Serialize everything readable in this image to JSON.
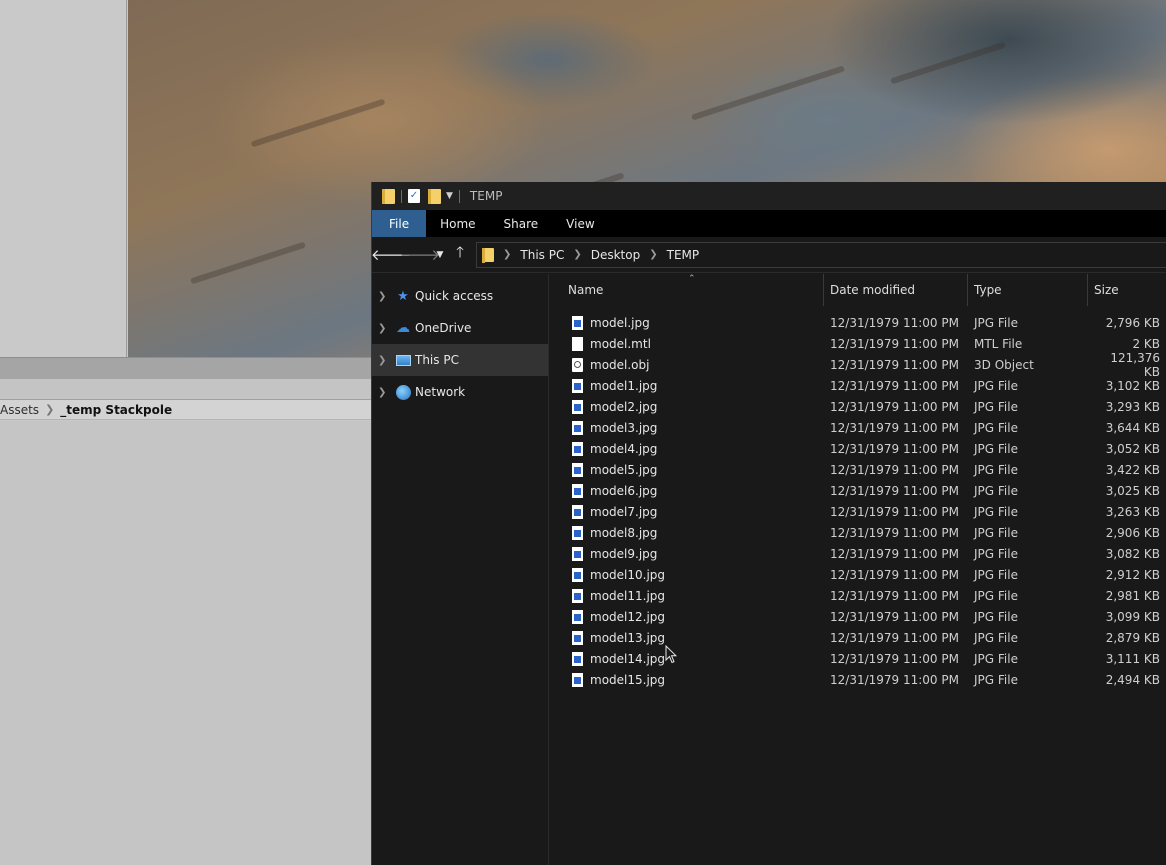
{
  "editor": {
    "breadcrumb": {
      "parent": "Assets",
      "current": "_temp Stackpole"
    }
  },
  "explorer": {
    "title": "TEMP",
    "ribbon_tabs": [
      "File",
      "Home",
      "Share",
      "View"
    ],
    "address": [
      "This PC",
      "Desktop",
      "TEMP"
    ],
    "nav_items": [
      {
        "label": "Quick access",
        "icon": "star-icon"
      },
      {
        "label": "OneDrive",
        "icon": "cloud-icon"
      },
      {
        "label": "This PC",
        "icon": "computer-icon",
        "selected": true
      },
      {
        "label": "Network",
        "icon": "network-icon"
      }
    ],
    "columns": {
      "name": "Name",
      "date": "Date modified",
      "type": "Type",
      "size": "Size"
    },
    "files": [
      {
        "name": "model.jpg",
        "date": "12/31/1979 11:00 PM",
        "type": "JPG File",
        "size": "2,796 KB",
        "icon": "jpg"
      },
      {
        "name": "model.mtl",
        "date": "12/31/1979 11:00 PM",
        "type": "MTL File",
        "size": "2 KB",
        "icon": "blank"
      },
      {
        "name": "model.obj",
        "date": "12/31/1979 11:00 PM",
        "type": "3D Object",
        "size": "121,376 KB",
        "icon": "obj"
      },
      {
        "name": "model1.jpg",
        "date": "12/31/1979 11:00 PM",
        "type": "JPG File",
        "size": "3,102 KB",
        "icon": "jpg"
      },
      {
        "name": "model2.jpg",
        "date": "12/31/1979 11:00 PM",
        "type": "JPG File",
        "size": "3,293 KB",
        "icon": "jpg"
      },
      {
        "name": "model3.jpg",
        "date": "12/31/1979 11:00 PM",
        "type": "JPG File",
        "size": "3,644 KB",
        "icon": "jpg"
      },
      {
        "name": "model4.jpg",
        "date": "12/31/1979 11:00 PM",
        "type": "JPG File",
        "size": "3,052 KB",
        "icon": "jpg"
      },
      {
        "name": "model5.jpg",
        "date": "12/31/1979 11:00 PM",
        "type": "JPG File",
        "size": "3,422 KB",
        "icon": "jpg"
      },
      {
        "name": "model6.jpg",
        "date": "12/31/1979 11:00 PM",
        "type": "JPG File",
        "size": "3,025 KB",
        "icon": "jpg"
      },
      {
        "name": "model7.jpg",
        "date": "12/31/1979 11:00 PM",
        "type": "JPG File",
        "size": "3,263 KB",
        "icon": "jpg"
      },
      {
        "name": "model8.jpg",
        "date": "12/31/1979 11:00 PM",
        "type": "JPG File",
        "size": "2,906 KB",
        "icon": "jpg"
      },
      {
        "name": "model9.jpg",
        "date": "12/31/1979 11:00 PM",
        "type": "JPG File",
        "size": "3,082 KB",
        "icon": "jpg"
      },
      {
        "name": "model10.jpg",
        "date": "12/31/1979 11:00 PM",
        "type": "JPG File",
        "size": "2,912 KB",
        "icon": "jpg"
      },
      {
        "name": "model11.jpg",
        "date": "12/31/1979 11:00 PM",
        "type": "JPG File",
        "size": "2,981 KB",
        "icon": "jpg"
      },
      {
        "name": "model12.jpg",
        "date": "12/31/1979 11:00 PM",
        "type": "JPG File",
        "size": "3,099 KB",
        "icon": "jpg"
      },
      {
        "name": "model13.jpg",
        "date": "12/31/1979 11:00 PM",
        "type": "JPG File",
        "size": "2,879 KB",
        "icon": "jpg"
      },
      {
        "name": "model14.jpg",
        "date": "12/31/1979 11:00 PM",
        "type": "JPG File",
        "size": "3,111 KB",
        "icon": "jpg"
      },
      {
        "name": "model15.jpg",
        "date": "12/31/1979 11:00 PM",
        "type": "JPG File",
        "size": "2,494 KB",
        "icon": "jpg"
      }
    ]
  }
}
